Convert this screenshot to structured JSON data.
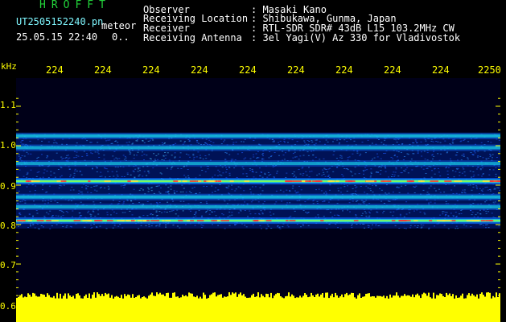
{
  "header": {
    "brand": "HROFFT",
    "filename": "UT2505152240.pn",
    "mode": "meteor",
    "datetime": "25.05.15 22:40",
    "number": "0..",
    "observer_label": "Observer",
    "observer_value": ": Masaki Kano",
    "location_label": "Receiving Location",
    "location_value": ": Shibukawa, Gunma, Japan",
    "receiver_label": "Receiver",
    "receiver_value": ": RTL-SDR SDR# 43dB L15 103.2MHz CW",
    "antenna_label": "Receiving Antenna",
    "antenna_value": ": 3el Yagi(V) Az 330 for Vladivostok"
  },
  "colors": {
    "background": "#000000",
    "header_green": "#22d33a",
    "tick_yellow": "#ffff00",
    "spectrum_yellow": "#ffff00"
  },
  "chart_data": {
    "type": "heatmap",
    "ylabel": "kHz",
    "xtick_labels": [
      "224",
      "224",
      "224",
      "224",
      "224",
      "224",
      "224",
      "224",
      "224",
      "2250"
    ],
    "yticks": [
      "1.1",
      "1.0",
      "0.9",
      "0.8",
      "0.7",
      "0.6"
    ],
    "ylim": [
      0.6,
      1.14
    ],
    "bands": [
      {
        "freq_khz": 1.025,
        "intensity": 0.55
      },
      {
        "freq_khz": 0.995,
        "intensity": 0.45
      },
      {
        "freq_khz": 0.955,
        "intensity": 0.35
      },
      {
        "freq_khz": 0.91,
        "intensity": 0.95
      },
      {
        "freq_khz": 0.87,
        "intensity": 0.55
      },
      {
        "freq_khz": 0.845,
        "intensity": 0.4
      },
      {
        "freq_khz": 0.81,
        "intensity": 0.9
      }
    ],
    "noise_region_khz": [
      0.79,
      1.03
    ],
    "spectrum_baseline_khz": 0.6
  }
}
